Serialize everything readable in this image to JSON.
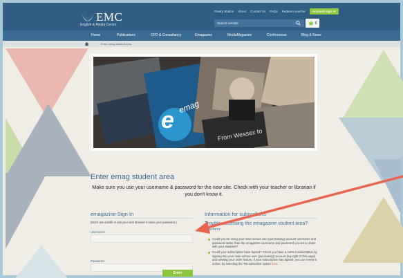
{
  "colors": {
    "header_blue": "#2f5e82",
    "nav_blue": "#3a6c93",
    "accent_green": "#8cc63f",
    "arrow_red": "#e8664f"
  },
  "header": {
    "logo_title": "EMC",
    "logo_subtitle": "English & Media Centre",
    "logo_icon": "emc-leaf-logo-icon",
    "top_links": [
      "Poetry Station",
      "About",
      "Contact Us",
      "FAQs",
      "Redeem voucher"
    ],
    "account_button": "Account sign in",
    "search_placeholder": "Search website",
    "basket_count": "0"
  },
  "nav": {
    "items": [
      "Home",
      "Publications",
      "CPD & Consultancy",
      "Emagazine",
      "MediaMagazine",
      "Conferences",
      "Blog & News"
    ]
  },
  "breadcrumb": {
    "current": "Enter emag student area"
  },
  "hero": {
    "image_title": "emag",
    "magazine_cover_text": "From Wessex to"
  },
  "main": {
    "title": "Enter emag student area",
    "intro": "Make sure you use your username & password for the new site. Check with your teacher or librarian if you don't know it.",
    "signin": {
      "heading": "emagazine Sign In",
      "autofill_note": "(Don't use autofill or ask your web browser to save your password.)",
      "username_label": "Username",
      "password_label": "Password",
      "enter_button": "Enter"
    },
    "info": {
      "heading": "Information for subscribers",
      "trouble_heading": "Trouble accessing the emagazine student area?",
      "teachers_label": "Teachers:",
      "bullet_1": "Could you be using your main school user (purchasing) account username and password rather than the emagazine username and password you set to share with your students?",
      "bullet_2_text": "Could your subscription have lapsed? Check you have a current subscription by signing into your main school user (purchasing) account (top right of this page) and viewing your order history. If your subscription has lapsed, you can renew it online, by selecting the 'Re-subscribe' option",
      "bullet_2_link": "here"
    }
  }
}
